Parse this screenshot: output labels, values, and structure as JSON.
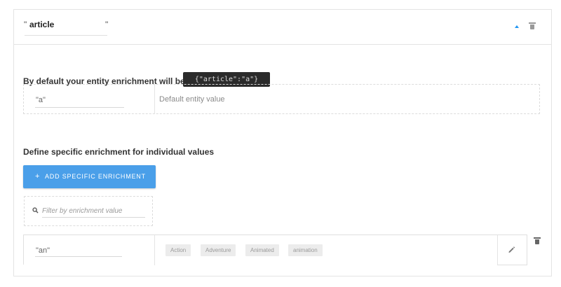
{
  "header": {
    "open_quote": "\"",
    "close_quote": "\"",
    "entity_name": "article"
  },
  "default_section": {
    "title": "By default your entity enrichment will be",
    "json_preview": "{\"article\":\"a\"}",
    "value": "\"a\"",
    "description": "Default entity value"
  },
  "specific_section": {
    "title": "Define specific enrichment for individual values",
    "add_button_label": "ADD SPECIFIC ENRICHMENT",
    "add_button_icon": "+",
    "filter_placeholder": "Filter by enrichment value"
  },
  "enrichment_rows": [
    {
      "value": "\"an\"",
      "tags": [
        "Action",
        "Adventure",
        "Animated",
        "animation"
      ]
    }
  ],
  "colors": {
    "accent": "#4a9fe9",
    "chevron": "#2196f3",
    "json_bg": "#2b2b2b",
    "chip_bg": "#ececec"
  },
  "icons": [
    "chevron-up-icon",
    "trash-icon",
    "search-icon",
    "pencil-icon",
    "plus-icon"
  ]
}
